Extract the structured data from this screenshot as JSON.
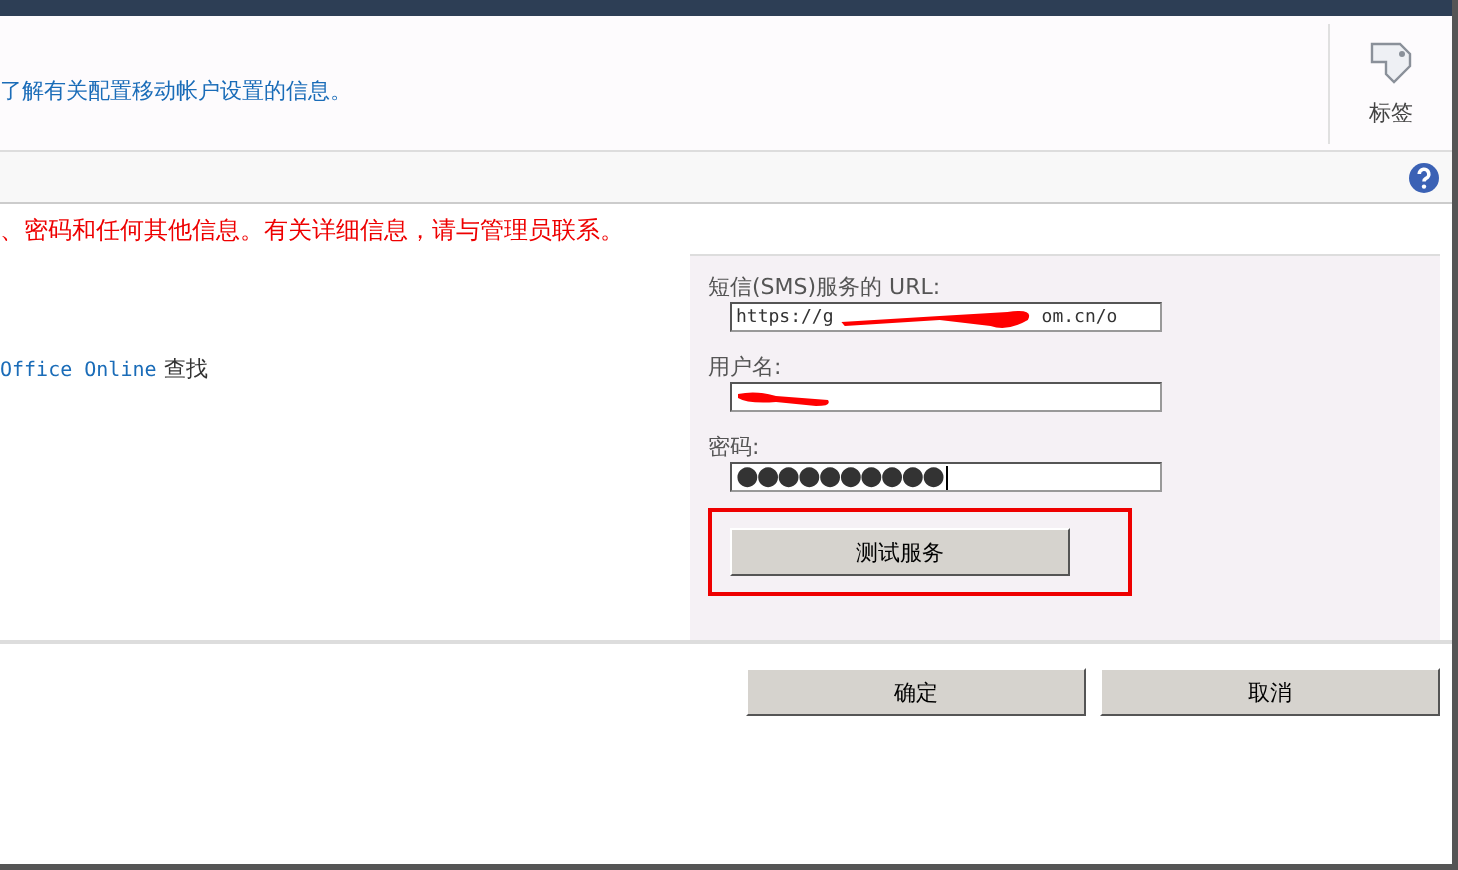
{
  "ribbon": {
    "info_text": "了解有关配置移动帐户设置的信息。",
    "tag_button": {
      "label": "标签"
    }
  },
  "notice": "、密码和任何其他信息。有关详细信息，请与管理员联系。",
  "left_text": {
    "link": "Office Online",
    "rest": "查找"
  },
  "form": {
    "url_label": "短信(SMS)服务的 URL:",
    "url_start": "https://g",
    "url_end": "om.cn/o",
    "username_label": "用户名:",
    "password_label": "密码:",
    "password_value": "●●●●●●●●●●",
    "test_button": "测试服务"
  },
  "buttons": [
    {
      "label": "确定"
    },
    {
      "label": "取消"
    }
  ]
}
